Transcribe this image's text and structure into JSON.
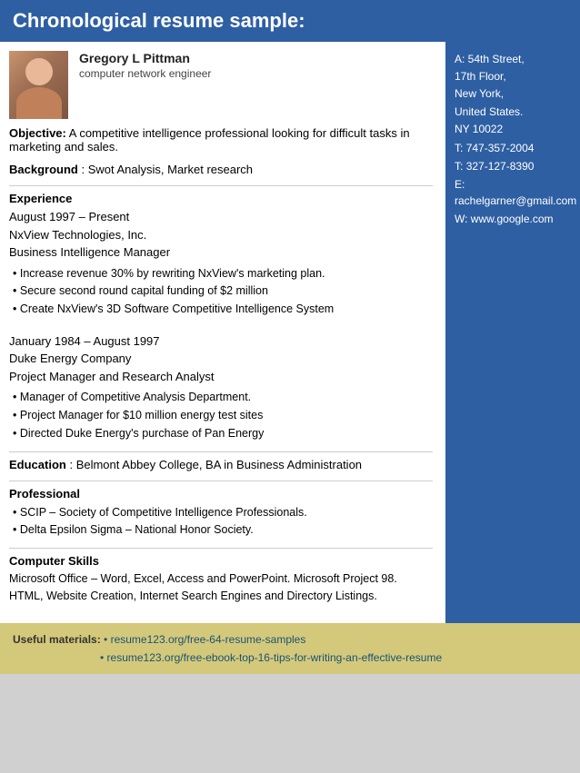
{
  "page": {
    "header": "Chronological resume sample:",
    "footer": {
      "label": "Useful materials:",
      "links": [
        "• resume123.org/free-64-resume-samples",
        "• resume123.org/free-ebook-top-16-tips-for-writing-an-effective-resume"
      ]
    }
  },
  "person": {
    "name": "Gregory L Pittman",
    "title": "computer network engineer"
  },
  "sidebar": {
    "address_line1": "A: 54th Street,",
    "address_line2": "17th Floor,",
    "address_line3": "New York,",
    "address_line4": "United States.",
    "address_line5": "NY 10022",
    "phone1_label": "T:",
    "phone1": "747-357-2004",
    "phone2_label": "T:",
    "phone2": "327-127-8390",
    "email_label": "E:",
    "email": "rachelgarner@gmail.com",
    "website_label": "W:",
    "website": "www.google.com"
  },
  "objective": {
    "label": "Objective:",
    "text": "A competitive intelligence professional looking for difficult tasks in marketing and sales."
  },
  "background": {
    "label": "Background",
    "text": ": Swot Analysis, Market research"
  },
  "experience": {
    "heading": "Experience",
    "jobs": [
      {
        "period": "August 1997 – Present",
        "company": "NxView Technologies, Inc.",
        "role": "Business Intelligence Manager",
        "bullets": [
          "Increase revenue 30% by rewriting NxView's marketing plan.",
          "Secure second round capital funding of $2 million",
          "Create NxView's 3D Software Competitive Intelligence System"
        ]
      },
      {
        "period": "January 1984 – August 1997",
        "company": "Duke Energy Company",
        "role": "Project Manager and Research Analyst",
        "bullets": [
          "Manager of Competitive Analysis Department.",
          "Project Manager for $10 million energy test sites",
          "Directed Duke Energy's purchase of Pan Energy"
        ]
      }
    ]
  },
  "education": {
    "label": "Education",
    "text": ": Belmont Abbey College, BA in Business Administration"
  },
  "professional": {
    "heading": "Professional",
    "bullets": [
      "SCIP – Society of Competitive Intelligence Professionals.",
      "Delta Epsilon Sigma – National Honor Society."
    ]
  },
  "computer_skills": {
    "heading": "Computer Skills",
    "text": "Microsoft Office – Word, Excel, Access and PowerPoint. Microsoft Project 98. HTML, Website Creation, Internet Search Engines and Directory Listings."
  }
}
